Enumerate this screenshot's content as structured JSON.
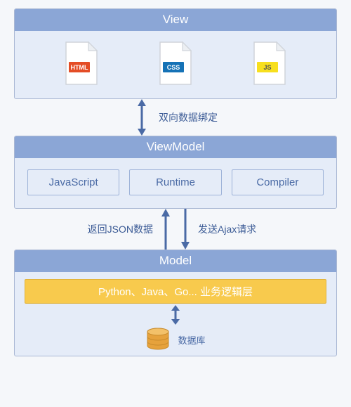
{
  "view": {
    "title": "View",
    "files": {
      "html": "HTML",
      "css": "CSS",
      "js": "JS"
    }
  },
  "connector1": {
    "label": "双向数据绑定"
  },
  "viewmodel": {
    "title": "ViewModel",
    "boxes": {
      "js": "JavaScript",
      "runtime": "Runtime",
      "compiler": "Compiler"
    }
  },
  "connector2": {
    "left_label": "返回JSON数据",
    "right_label": "发送Ajax请求"
  },
  "model": {
    "title": "Model",
    "business_layer": "Python、Java、Go... 业务逻辑层",
    "database_label": "数据库"
  },
  "colors": {
    "panel_header": "#8ba6d6",
    "panel_body": "#e5ecf8",
    "accent_arrow": "#4a6aa5",
    "business": "#f8ca4d",
    "db": "#e6a23c"
  }
}
